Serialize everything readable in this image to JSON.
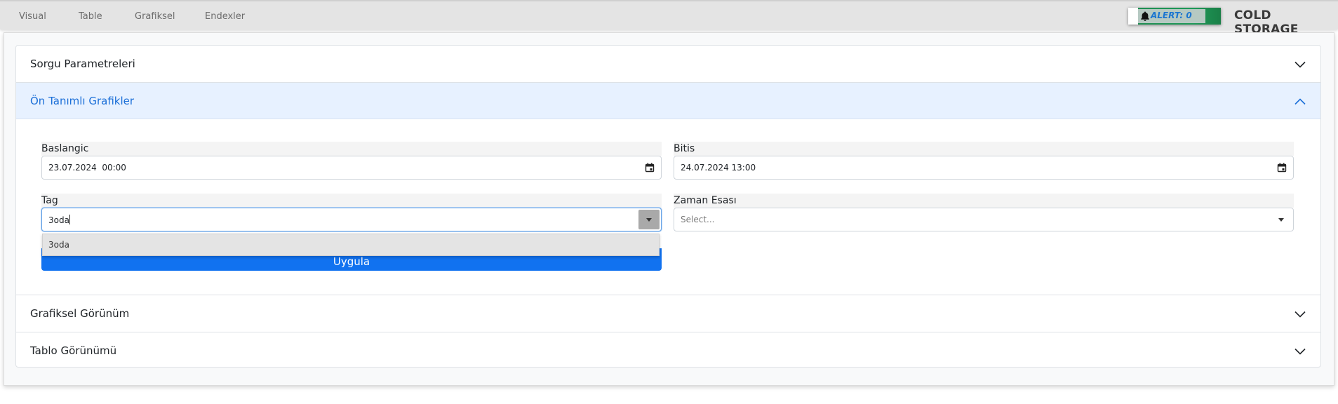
{
  "nav": {
    "items": [
      "Visual",
      "Table",
      "Grafiksel",
      "Endexler"
    ]
  },
  "alert": {
    "label": "ALERT: 0",
    "icon": "bell-icon"
  },
  "brand": {
    "title": "COLD STORAGE"
  },
  "accordion": {
    "sections": [
      {
        "title": "Sorgu Parametreleri",
        "expanded": false
      },
      {
        "title": "Ön Tanımlı Grafikler",
        "expanded": true
      },
      {
        "title": "Grafiksel Görünüm",
        "expanded": false
      },
      {
        "title": "Tablo Görünümü",
        "expanded": false
      }
    ]
  },
  "form": {
    "start": {
      "label": "Baslangic",
      "value": "23.07.2024  00:00"
    },
    "end": {
      "label": "Bitis",
      "value": "24.07.2024 13:00"
    },
    "tag": {
      "label": "Tag",
      "value": "3oda"
    },
    "time_basis": {
      "label": "Zaman Esası",
      "placeholder": "Select..."
    },
    "apply_label": "Uygula",
    "tag_dropdown_options": [
      "3oda"
    ]
  },
  "colors": {
    "accent": "#1172f0",
    "active_header_bg": "#e7f1ff",
    "active_header_text": "#1b6fd8",
    "alert_green": "#1e9a58"
  }
}
